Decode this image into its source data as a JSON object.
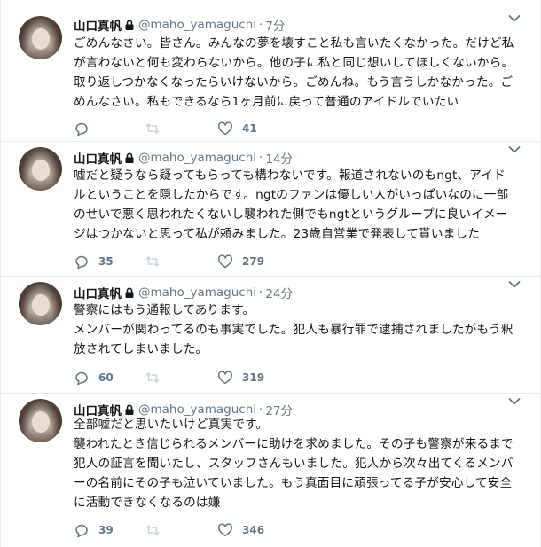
{
  "tweets": [
    {
      "name": "山口真帆",
      "handle": "@maho_yamaguchi",
      "separator": "·",
      "time": "7分",
      "lines": [
        "ごめんなさい。皆さん。みんなの夢を壊すこと私も言いたくなかった。だけど私",
        "が言わないと何も変わらないから。他の子に私と同じ想いしてほしくないから。",
        "取り返しつかなくなったらいけないから。ごめんね。もう言うしかなかった。ご",
        "めんなさい。私もできるなら1ヶ月前に戻って普通のアイドルでいたい"
      ],
      "reply_count": "",
      "retweet_count": "",
      "like_count": "41"
    },
    {
      "name": "山口真帆",
      "handle": "@maho_yamaguchi",
      "separator": "·",
      "time": "14分",
      "lines": [
        "嘘だと疑うなら疑ってもらっても構わないです。報道されないのもngt、アイド",
        "ルということを隠したからです。ngtのファンは優しい人がいっぱいなのに一部",
        "のせいで悪く思われたくないし襲われた側でもngtというグループに良いイメー",
        "ジはつかないと思って私が頼みました。23歳自営業で発表して貰いました"
      ],
      "reply_count": "35",
      "retweet_count": "",
      "like_count": "279"
    },
    {
      "name": "山口真帆",
      "handle": "@maho_yamaguchi",
      "separator": "·",
      "time": "24分",
      "lines": [
        "警察にはもう通報してあります。",
        "メンバーが関わってるのも事実でした。犯人も暴行罪で逮捕されましたがもう釈",
        "放されてしまいました。"
      ],
      "reply_count": "60",
      "retweet_count": "",
      "like_count": "319"
    },
    {
      "name": "山口真帆",
      "handle": "@maho_yamaguchi",
      "separator": "·",
      "time": "27分",
      "lines": [
        "全部嘘だと思いたいけど真実です。",
        "襲われたとき信じられるメンバーに助けを求めました。その子も警察が来るまで",
        "犯人の証言を聞いたし、スタッフさんもいました。犯人から次々出てくるメンバ",
        "ーの名前にその子も泣いていました。もう真面目に頑張ってる子が安心して安全",
        "に活動できなくなるのは嫌"
      ],
      "reply_count": "39",
      "retweet_count": "",
      "like_count": "346"
    }
  ],
  "icons": {
    "lock": "lock-icon",
    "caret": "chevron-down-icon",
    "reply": "reply-icon",
    "retweet": "retweet-icon",
    "like": "heart-icon"
  },
  "colors": {
    "text": "#14171a",
    "secondary": "#657786",
    "border": "#e6ecf0",
    "icon": "#657786"
  }
}
